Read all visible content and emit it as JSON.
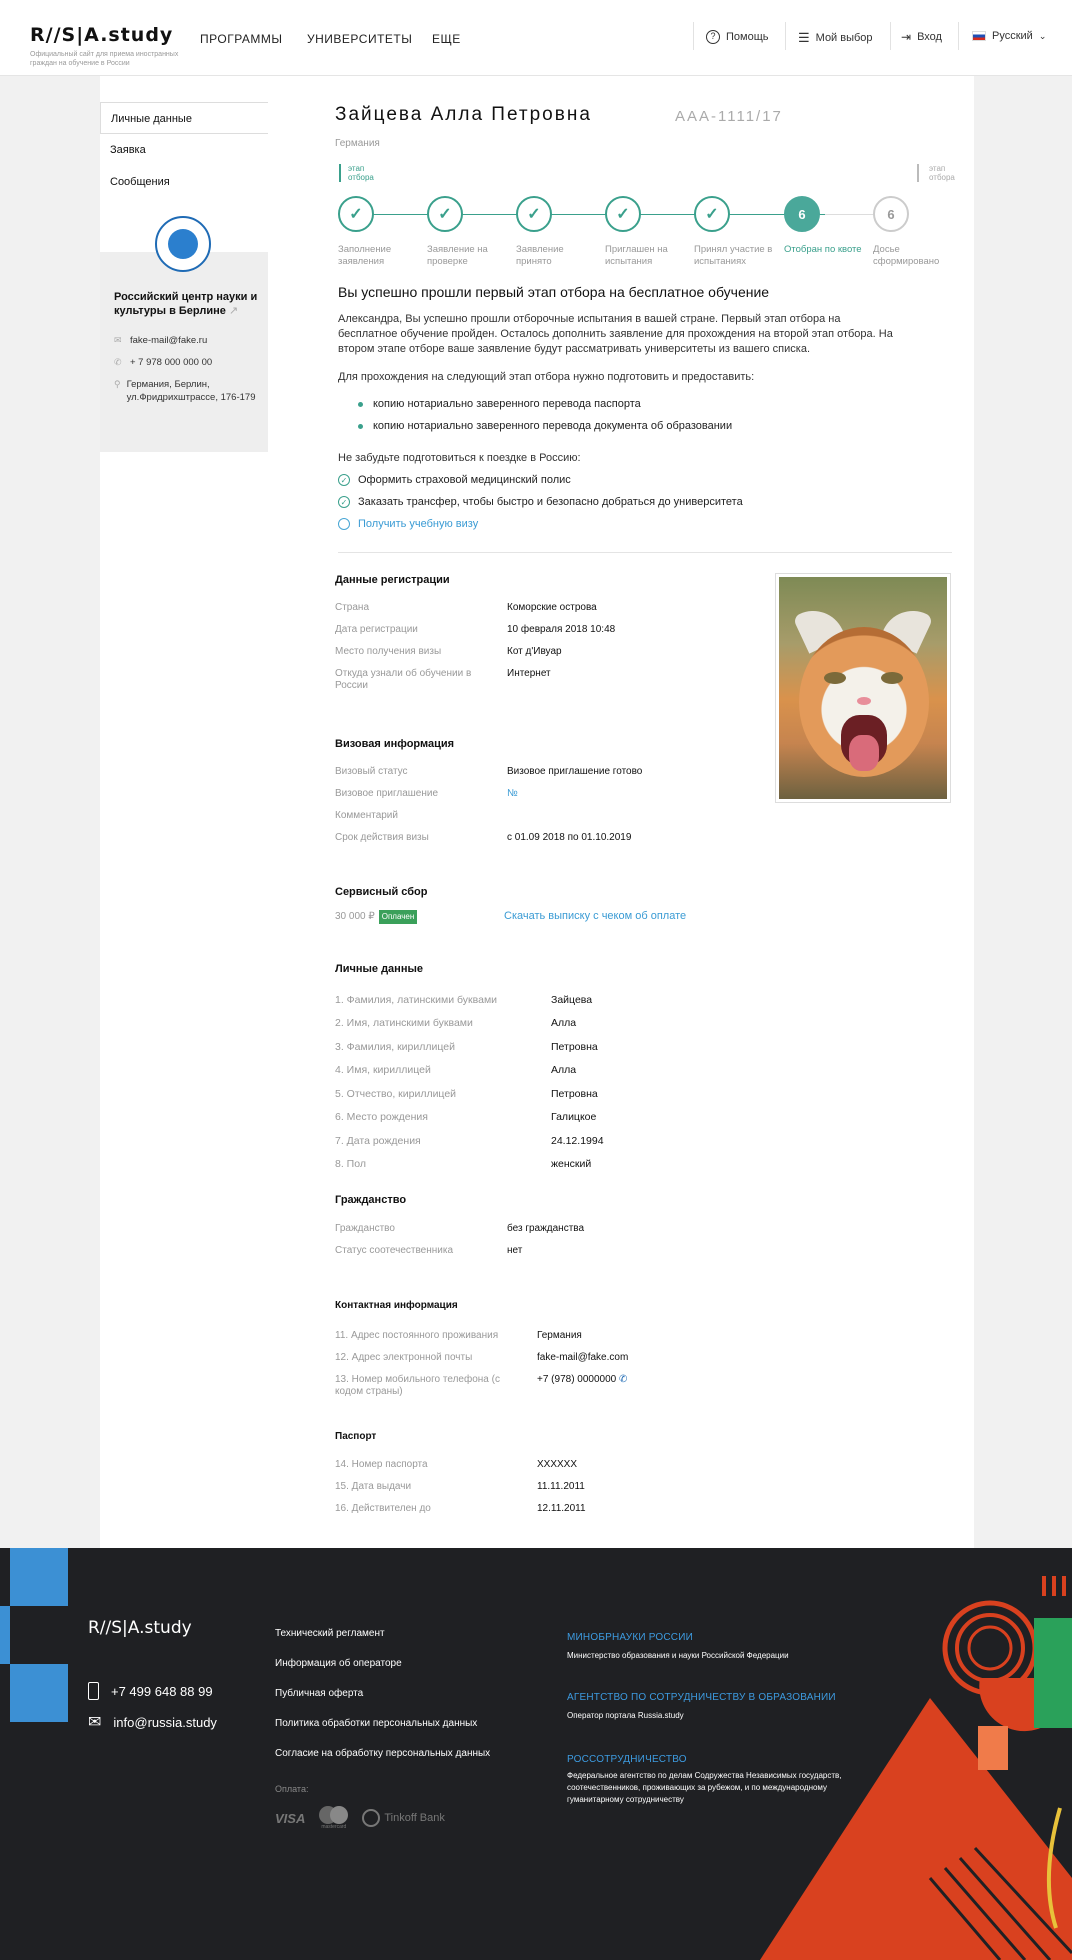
{
  "header": {
    "logo": "R//S|A.study",
    "logo_sub": "Официальный сайт для приема иностранных граждан на обучение в России",
    "nav": [
      "ПРОГРАММЫ",
      "УНИВЕРСИТЕТЫ",
      "ЕЩЕ"
    ],
    "help": "Помощь",
    "my_choice": "Мой выбор",
    "login": "Вход",
    "language": "Русский"
  },
  "sidebar": {
    "items": [
      "Личные данные",
      "Заявка",
      "Сообщения"
    ],
    "center": {
      "title": "Российский центр науки и культуры в Берлине",
      "email": "fake-mail@fake.ru",
      "phone": "+ 7 978 000 000 00",
      "address": "Германия, Берлин, ул.Фридрихштрассе, 176-179"
    }
  },
  "profile": {
    "name": "Зайцева Алла Петровна",
    "code": "AAA-1111/17",
    "country": "Германия",
    "stage1": "этап отбора",
    "stage2": "этап отбора"
  },
  "steps": [
    {
      "label": "Заполнение заявления",
      "state": "done"
    },
    {
      "label": "Заявление на проверке",
      "state": "done"
    },
    {
      "label": "Заявление принято",
      "state": "done"
    },
    {
      "label": "Приглашен на испытания",
      "state": "done"
    },
    {
      "label": "Принял участие в испытаниях",
      "state": "done"
    },
    {
      "label": "Отобран по квоте",
      "state": "current",
      "num": "6"
    },
    {
      "label": "Досье сформировано",
      "state": "next",
      "num": "6"
    }
  ],
  "message": {
    "title": "Вы успешно прошли первый этап отбора на бесплатное обучение",
    "p1": "Александра, Вы успешно прошли отборочные испытания в вашей стране. Первый этап отбора на бесплатное обучение пройден. Осталось дополнить заявление для прохождения на второй этап отбора. На втором этапе отборе ваше заявление будут рассматривать университеты из вашего списка.",
    "p2": "Для прохождения на следующий этап отбора нужно подготовить и предоставить:",
    "bullets": [
      "копию нотариально заверенного перевода паспорта",
      "копию нотариально заверенного перевода документа об образовании"
    ],
    "p3": "Не забудьте подготовиться к поездке в Россию:",
    "checks": [
      "Оформить страховой медицинский полис",
      "Заказать трансфер, чтобы быстро и безопасно добраться до университета"
    ],
    "todo": "Получить учебную визу"
  },
  "registration": {
    "title": "Данные регистрации",
    "rows": [
      {
        "label": "Страна",
        "value": "Коморские острова"
      },
      {
        "label": "Дата регистрации",
        "value": "10 февраля 2018 10:48"
      },
      {
        "label": "Место получения визы",
        "value": "Кот д'Ивуар"
      },
      {
        "label": "Откуда узнали об обучении в России",
        "value": "Интернет"
      }
    ]
  },
  "visa": {
    "title": "Визовая информация",
    "rows": [
      {
        "label": "Визовый статус",
        "value": "Визовое приглашение готово"
      },
      {
        "label": "Визовое приглашение",
        "value": "№"
      },
      {
        "label": "Комментарий",
        "value": ""
      },
      {
        "label": "Срок действия визы",
        "value": "с 01.09 2018 по 01.10.2019"
      }
    ]
  },
  "fee": {
    "title": "Сервисный сбор",
    "amount": "30 000 ₽",
    "status": "Оплачен",
    "download": "Скачать выписку с чеком об оплате"
  },
  "personal": {
    "title": "Личные данные",
    "rows": [
      {
        "label": "1. Фамилия, латинскими буквами",
        "value": "Зайцева"
      },
      {
        "label": "2. Имя, латинскими буквами",
        "value": "Алла"
      },
      {
        "label": "3. Фамилия, кириллицей",
        "value": "Петровна"
      },
      {
        "label": "4. Имя, кириллицей",
        "value": "Алла"
      },
      {
        "label": "5. Отчество, кириллицей",
        "value": "Петровна"
      },
      {
        "label": "6. Место рождения",
        "value": "Галицкое"
      },
      {
        "label": "7. Дата рождения",
        "value": "24.12.1994"
      },
      {
        "label": "8. Пол",
        "value": "женский"
      }
    ]
  },
  "citizenship": {
    "title": "Гражданство",
    "rows": [
      {
        "label": "Гражданство",
        "value": "без гражданства"
      },
      {
        "label": "Статус соотечественника",
        "value": "нет"
      }
    ]
  },
  "contacts": {
    "title": "Контактная информация",
    "rows": [
      {
        "label": "11. Адрес постоянного проживания",
        "value": "Германия"
      },
      {
        "label": "12. Адрес электронной почты",
        "value": "fake-mail@fake.com"
      },
      {
        "label": "13. Номер мобильного телефона (с кодом страны)",
        "value": "+7 (978) 0000000"
      }
    ]
  },
  "passport": {
    "title": "Паспорт",
    "rows": [
      {
        "label": "14. Номер паспорта",
        "value": "XXXXXX"
      },
      {
        "label": "15. Дата выдачи",
        "value": "11.11.2011"
      },
      {
        "label": "16. Действителен до",
        "value": "12.11.2011"
      }
    ]
  },
  "footer": {
    "logo": "R//S|A.study",
    "phone": "+7 499 648 88 99",
    "email": "info@russia.study",
    "links": [
      "Технический регламент",
      "Информация об операторе",
      "Публичная оферта",
      "Политика обработки персональных данных",
      "Согласие на обработку персональных данных"
    ],
    "payment_label": "Оплата:",
    "payment": [
      "VISA",
      "mastercard",
      "Tinkoff Bank"
    ],
    "orgs": [
      {
        "title": "МИНОБРНАУКИ РОССИИ",
        "text": "Министерство образования и науки Российской Федерации"
      },
      {
        "title": "АГЕНТСТВО ПО СОТРУДНИЧЕСТВУ В ОБРАЗОВАНИИ",
        "text": "Оператор портала Russia.study"
      },
      {
        "title": "РОССОТРУДНИЧЕСТВО",
        "text": "Федеральное агентство по делам Содружества Независимых государств, соотечественников, проживающих за рубежом, и по международному гуманитарному сотрудничеству"
      }
    ]
  }
}
